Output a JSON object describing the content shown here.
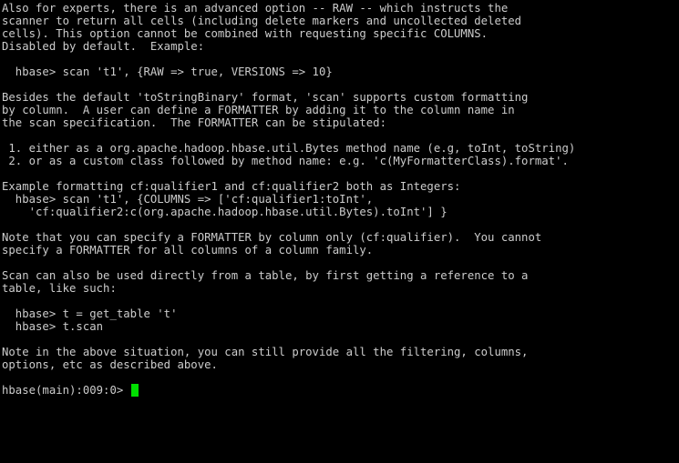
{
  "terminal": {
    "background_color": "#000000",
    "foreground_color": "#cccccc",
    "cursor_color": "#00e000",
    "lines": [
      "Also for experts, there is an advanced option -- RAW -- which instructs the",
      "scanner to return all cells (including delete markers and uncollected deleted",
      "cells). This option cannot be combined with requesting specific COLUMNS.",
      "Disabled by default.  Example:",
      "",
      "  hbase> scan 't1', {RAW => true, VERSIONS => 10}",
      "",
      "Besides the default 'toStringBinary' format, 'scan' supports custom formatting",
      "by column.  A user can define a FORMATTER by adding it to the column name in",
      "the scan specification.  The FORMATTER can be stipulated:",
      "",
      " 1. either as a org.apache.hadoop.hbase.util.Bytes method name (e.g, toInt, toString)",
      " 2. or as a custom class followed by method name: e.g. 'c(MyFormatterClass).format'.",
      "",
      "Example formatting cf:qualifier1 and cf:qualifier2 both as Integers:",
      "  hbase> scan 't1', {COLUMNS => ['cf:qualifier1:toInt',",
      "    'cf:qualifier2:c(org.apache.hadoop.hbase.util.Bytes).toInt'] }",
      "",
      "Note that you can specify a FORMATTER by column only (cf:qualifier).  You cannot",
      "specify a FORMATTER for all columns of a column family.",
      "",
      "Scan can also be used directly from a table, by first getting a reference to a",
      "table, like such:",
      "",
      "  hbase> t = get_table 't'",
      "  hbase> t.scan",
      "",
      "Note in the above situation, you can still provide all the filtering, columns,",
      "options, etc as described above.",
      ""
    ],
    "prompt": "hbase(main):009:0> ",
    "input_value": ""
  }
}
